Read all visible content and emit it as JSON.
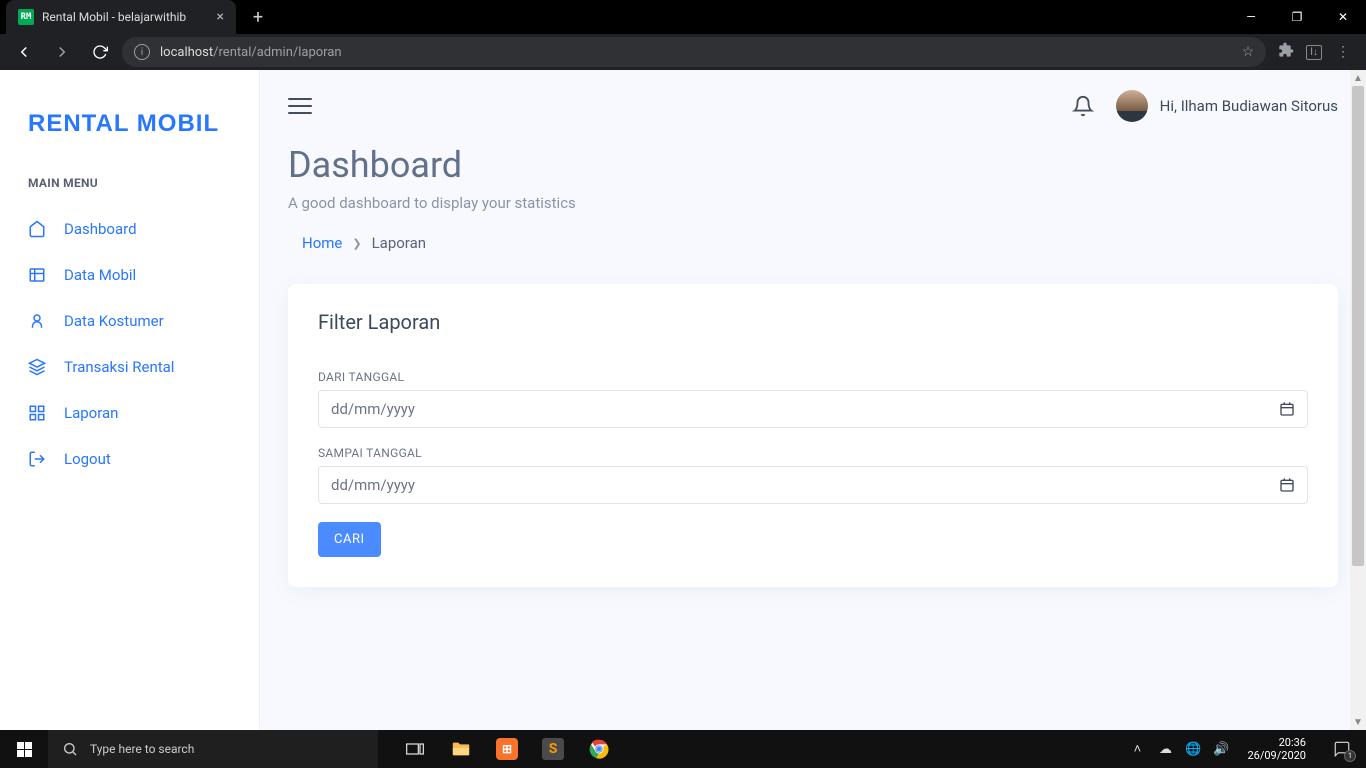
{
  "browser": {
    "tab_favicon": "RM",
    "tab_title": "Rental Mobil - belajarwithib",
    "url_host": "localhost",
    "url_path": "/rental/admin/laporan"
  },
  "sidebar": {
    "logo": "RENTAL MOBIL",
    "menu_header": "MAIN MENU",
    "items": [
      {
        "label": "Dashboard"
      },
      {
        "label": "Data Mobil"
      },
      {
        "label": "Data Kostumer"
      },
      {
        "label": "Transaksi Rental"
      },
      {
        "label": "Laporan"
      },
      {
        "label": "Logout"
      }
    ]
  },
  "topbar": {
    "greeting": "Hi, Ilham Budiawan Sitorus"
  },
  "header": {
    "title": "Dashboard",
    "subtitle": "A good dashboard to display your statistics",
    "breadcrumb_home": "Home",
    "breadcrumb_current": "Laporan"
  },
  "card": {
    "title": "Filter Laporan",
    "from_label": "DARI TANGGAL",
    "to_label": "SAMPAI TANGGAL",
    "placeholder": "dd/mm/yyyy",
    "submit": "CARI"
  },
  "taskbar": {
    "search_placeholder": "Type here to search",
    "time": "20:36",
    "date": "26/09/2020",
    "notif_count": "1"
  }
}
